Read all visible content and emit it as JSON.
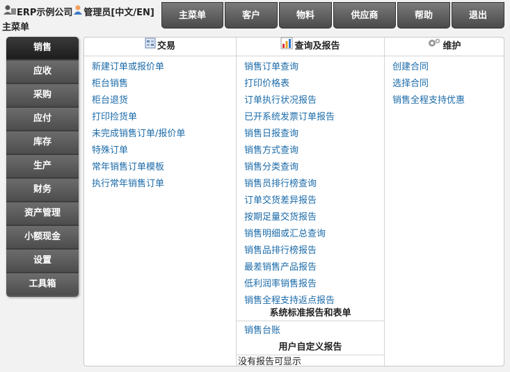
{
  "header": {
    "company": "ERP示例公司",
    "user": "管理员[中文/EN]",
    "menu_label": "主菜单"
  },
  "topnav": [
    {
      "label": "主菜单"
    },
    {
      "label": "客户"
    },
    {
      "label": "物料"
    },
    {
      "label": "供应商"
    },
    {
      "label": "帮助"
    },
    {
      "label": "退出"
    }
  ],
  "sidebar": [
    {
      "label": "销售"
    },
    {
      "label": "应收"
    },
    {
      "label": "采购"
    },
    {
      "label": "应付"
    },
    {
      "label": "库存"
    },
    {
      "label": "生产"
    },
    {
      "label": "财务"
    },
    {
      "label": "资产管理"
    },
    {
      "label": "小额现金"
    },
    {
      "label": "设置"
    },
    {
      "label": "工具箱"
    }
  ],
  "transactions": {
    "title": "交易",
    "links": [
      "新建订单或报价单",
      "柜台销售",
      "柜台退货",
      "打印捡货单",
      "未完成销售订单/报价单",
      "特殊订单",
      "常年销售订单模板",
      "执行常年销售订单"
    ]
  },
  "queries": {
    "title": "查询及报告",
    "links": [
      "销售订单查询",
      "打印价格表",
      "订单执行状况报告",
      "已开系统发票订单报告",
      "销售日报查询",
      "销售方式查询",
      "销售分类查询",
      "销售员排行榜查询",
      "订单交货差异报告",
      "按期足量交货报告",
      "销售明细或汇总查询",
      "销售品排行榜报告",
      "最差销售产品报告",
      "低利润率销售报告",
      "销售全程支持返点报告"
    ],
    "std_title": "系统标准报告和表单",
    "std_links": [
      "销售台账"
    ],
    "custom_title": "用户自定义报告",
    "custom_empty": "没有报告可显示"
  },
  "maintenance": {
    "title": "维护",
    "links": [
      "创建合同",
      "选择合同",
      "销售全程支持优惠"
    ]
  }
}
